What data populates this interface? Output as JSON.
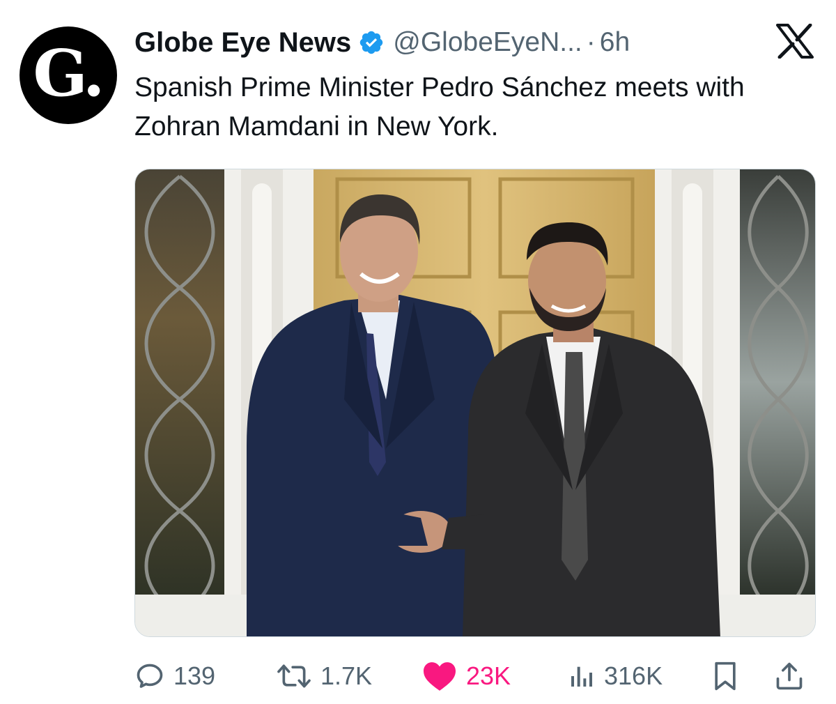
{
  "account": {
    "avatar_letter": "G.",
    "name": "Globe Eye News",
    "handle": "@GlobeEyeN...",
    "separator": "·",
    "time": "6h"
  },
  "tweet": {
    "text": "Spanish Prime Minister Pedro Sánchez meets with Zohran Mamdani in New York."
  },
  "actions": {
    "replies": "139",
    "retweets": "1.7K",
    "likes": "23K",
    "views": "316K"
  },
  "icons": {
    "verified": "verified-badge-icon",
    "platform": "x-logo-icon",
    "reply": "reply-icon",
    "retweet": "retweet-icon",
    "like": "heart-icon",
    "views": "views-icon",
    "bookmark": "bookmark-icon",
    "share": "share-icon"
  },
  "colors": {
    "verified": "#1d9bf0",
    "like_active": "#f91880",
    "secondary_text": "#536471",
    "primary_text": "#0f1419"
  }
}
